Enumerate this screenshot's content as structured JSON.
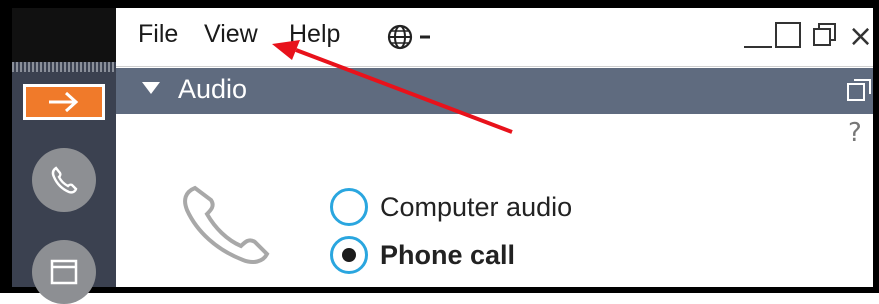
{
  "menubar": {
    "file": "File",
    "view": "View",
    "help": "Help"
  },
  "audio": {
    "title": "Audio",
    "help": "?",
    "options": [
      {
        "label": "Computer audio",
        "selected": false
      },
      {
        "label": "Phone call",
        "selected": true
      }
    ]
  },
  "colors": {
    "accent_orange": "#f07a2a",
    "header_bg": "#5f6b7f",
    "radio_border": "#2aa6df",
    "annotation_arrow": "#e8121b"
  },
  "icons": [
    "globe-icon",
    "chevron-down-icon",
    "minimize-icon",
    "maximize-icon",
    "restore-icon",
    "close-icon",
    "popout-icon",
    "arrow-right-icon",
    "phone-icon",
    "window-icon"
  ]
}
